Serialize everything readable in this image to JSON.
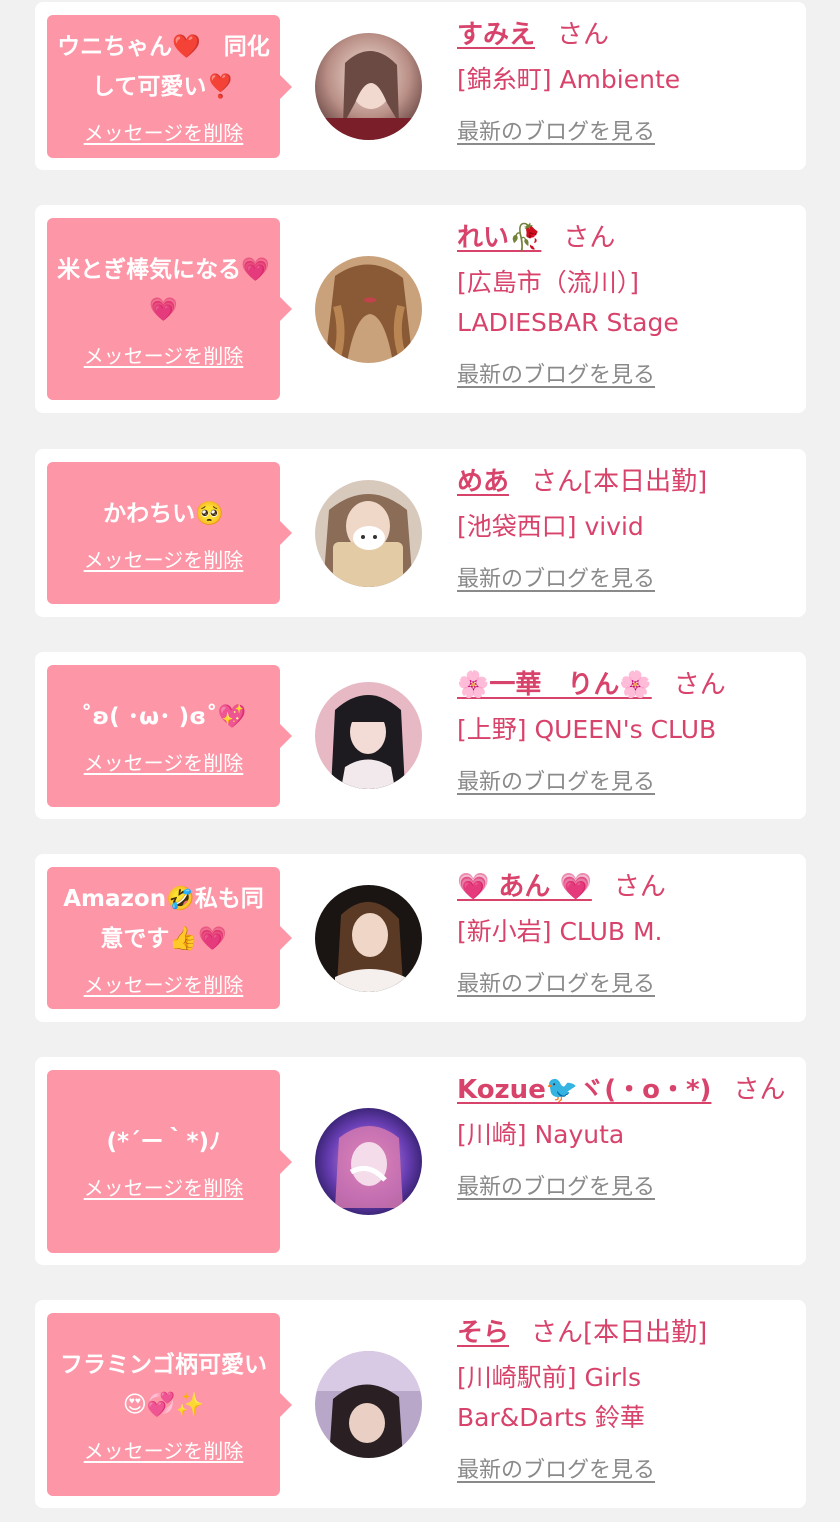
{
  "delete_label": "メッセージを削除",
  "blog_label": "最新のブログを見る",
  "honorific": "さん",
  "entries": [
    {
      "message": "ウニちゃん❤️　同化して可愛い❣️",
      "name": "すみえ",
      "status": "",
      "shop": "[錦糸町] Ambiente"
    },
    {
      "message": "米とぎ棒気になる💗💗",
      "name": "れい🥀",
      "status": "",
      "shop": "[広島市（流川）] LADIESBAR Stage"
    },
    {
      "message": "かわちい🥺",
      "name": "めあ",
      "status": "[本日出勤]",
      "shop": "[池袋西口] vivid"
    },
    {
      "message": "˚ʚ( ･ω･ )ɞ˚💖",
      "name": "🌸一華　りん🌸",
      "status": "",
      "shop": "[上野] QUEEN's CLUB"
    },
    {
      "message": "Amazon🤣私も同意です👍💗",
      "name": "💗 あん 💗",
      "status": "",
      "shop": "[新小岩] CLUB M."
    },
    {
      "message": "(*´ー｀*)ﾉ",
      "name": "Kozue🐦ヾ(・o・*)",
      "status": "",
      "shop": "[川崎] Nayuta"
    },
    {
      "message": "フラミンゴ柄可愛い😍💞✨",
      "name": "そら",
      "status": "[本日出勤]",
      "shop": "[川崎駅前] Girls Bar&Darts 鈴華"
    }
  ],
  "colors": {
    "page_bg": "#f1f1f1",
    "card_bg": "#ffffff",
    "bubble_bg": "#fd96a6",
    "accent": "#d8436b",
    "muted_link": "#8a8a8a"
  }
}
